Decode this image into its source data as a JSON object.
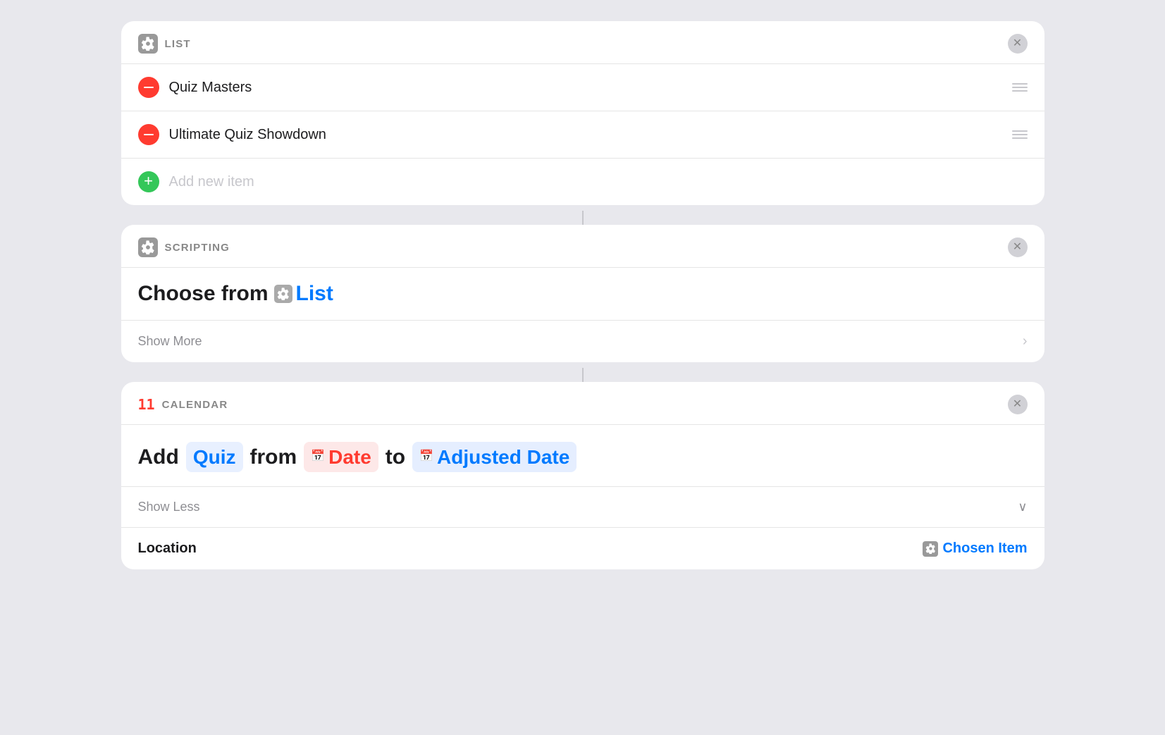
{
  "list_card": {
    "header_label": "LIST",
    "items": [
      {
        "id": 1,
        "text": "Quiz Masters"
      },
      {
        "id": 2,
        "text": "Ultimate Quiz Showdown"
      }
    ],
    "add_placeholder": "Add new item"
  },
  "scripting_card": {
    "header_label": "SCRIPTING",
    "title_prefix": "Choose from",
    "list_label": "List",
    "show_more_label": "Show More"
  },
  "calendar_card": {
    "header_label": "CALENDAR",
    "add_label": "Add",
    "quiz_label": "Quiz",
    "from_label": "from",
    "date_label": "Date",
    "to_label": "to",
    "adjusted_date_label": "Adjusted Date",
    "show_less_label": "Show Less",
    "location_label": "Location",
    "chosen_item_label": "Chosen Item"
  },
  "icons": {
    "gear": "⚙",
    "calendar": "11",
    "chevron_right": "›",
    "chevron_down": "∨"
  }
}
